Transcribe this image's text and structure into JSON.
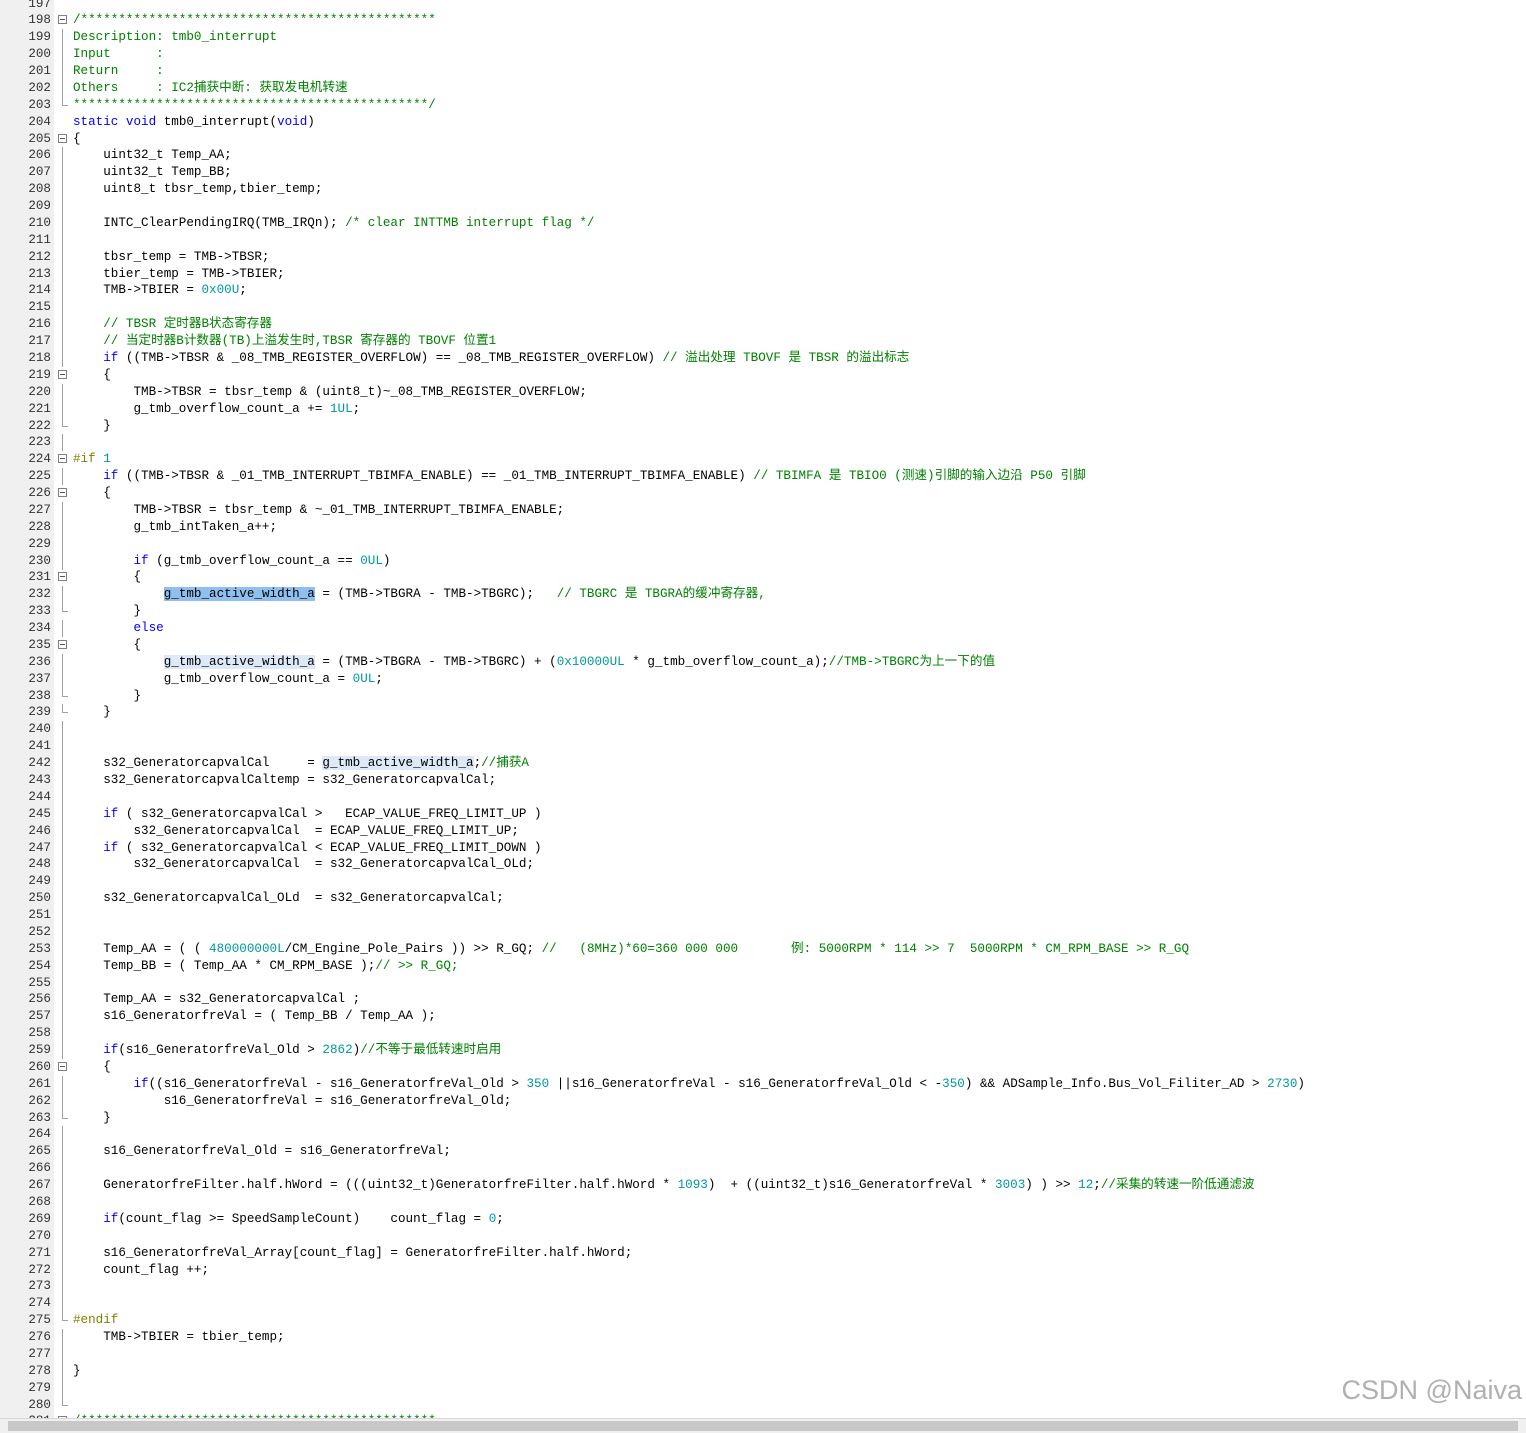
{
  "watermark": "CSDN @Naiva",
  "lines": [
    {
      "n": "197",
      "s": []
    },
    {
      "n": "198",
      "f": "box",
      "s": [
        {
          "t": "/***********************************************",
          "c": "c"
        }
      ]
    },
    {
      "n": "199",
      "f": "line",
      "s": [
        {
          "t": "Description: tmb0_interrupt",
          "c": "c"
        }
      ]
    },
    {
      "n": "200",
      "f": "line",
      "s": [
        {
          "t": "Input      :",
          "c": "c"
        }
      ]
    },
    {
      "n": "201",
      "f": "line",
      "s": [
        {
          "t": "Return     :",
          "c": "c"
        }
      ]
    },
    {
      "n": "202",
      "f": "line",
      "s": [
        {
          "t": "Others     : IC2捕获中断: 获取发电机转速",
          "c": "c"
        }
      ]
    },
    {
      "n": "203",
      "f": "end",
      "s": [
        {
          "t": "***********************************************/",
          "c": "c"
        }
      ]
    },
    {
      "n": "204",
      "s": [
        {
          "t": "static void",
          "c": "k"
        },
        {
          "t": " tmb0_interrupt("
        },
        {
          "t": "void",
          "c": "k"
        },
        {
          "t": ")"
        }
      ]
    },
    {
      "n": "205",
      "f": "box",
      "s": [
        {
          "t": "{"
        }
      ]
    },
    {
      "n": "206",
      "f": "line",
      "s": [
        {
          "t": "    uint32_t Temp_AA;"
        }
      ]
    },
    {
      "n": "207",
      "f": "line",
      "s": [
        {
          "t": "    uint32_t Temp_BB;"
        }
      ]
    },
    {
      "n": "208",
      "f": "line",
      "s": [
        {
          "t": "    uint8_t tbsr_temp,tbier_temp;"
        }
      ]
    },
    {
      "n": "209",
      "f": "line",
      "s": []
    },
    {
      "n": "210",
      "f": "line",
      "s": [
        {
          "t": "    INTC_ClearPendingIRQ(TMB_IRQn); "
        },
        {
          "t": "/* clear INTTMB interrupt flag */",
          "c": "c"
        }
      ]
    },
    {
      "n": "211",
      "f": "line",
      "s": []
    },
    {
      "n": "212",
      "f": "line",
      "s": [
        {
          "t": "    tbsr_temp = TMB->TBSR;"
        }
      ]
    },
    {
      "n": "213",
      "f": "line",
      "s": [
        {
          "t": "    tbier_temp = TMB->TBIER;"
        }
      ]
    },
    {
      "n": "214",
      "f": "line",
      "s": [
        {
          "t": "    TMB->TBIER = "
        },
        {
          "t": "0x00U",
          "c": "n"
        },
        {
          "t": ";"
        }
      ]
    },
    {
      "n": "215",
      "f": "line",
      "s": []
    },
    {
      "n": "216",
      "f": "line",
      "s": [
        {
          "t": "    // TBSR 定时器B状态寄存器",
          "c": "c"
        }
      ]
    },
    {
      "n": "217",
      "f": "line",
      "s": [
        {
          "t": "    // 当定时器B计数器(TB)上溢发生时,TBSR 寄存器的 TBOVF 位置1",
          "c": "c"
        }
      ]
    },
    {
      "n": "218",
      "f": "line",
      "s": [
        {
          "t": "    "
        },
        {
          "t": "if",
          "c": "k"
        },
        {
          "t": " ((TMB->TBSR & _08_TMB_REGISTER_OVERFLOW) == _08_TMB_REGISTER_OVERFLOW) "
        },
        {
          "t": "// 溢出处理 TBOVF 是 TBSR 的溢出标志",
          "c": "c"
        }
      ]
    },
    {
      "n": "219",
      "f": "box",
      "s": [
        {
          "t": "    {"
        }
      ]
    },
    {
      "n": "220",
      "f": "line",
      "s": [
        {
          "t": "        TMB->TBSR = tbsr_temp & (uint8_t)~_08_TMB_REGISTER_OVERFLOW;"
        }
      ]
    },
    {
      "n": "221",
      "f": "line",
      "s": [
        {
          "t": "        g_tmb_overflow_count_a += "
        },
        {
          "t": "1UL",
          "c": "n"
        },
        {
          "t": ";"
        }
      ]
    },
    {
      "n": "222",
      "f": "end",
      "s": [
        {
          "t": "    }"
        }
      ]
    },
    {
      "n": "223",
      "f": "line",
      "s": []
    },
    {
      "n": "224",
      "f": "box",
      "s": [
        {
          "t": "#if",
          "c": "p"
        },
        {
          "t": " "
        },
        {
          "t": "1",
          "c": "n"
        }
      ]
    },
    {
      "n": "225",
      "f": "line",
      "s": [
        {
          "t": "    "
        },
        {
          "t": "if",
          "c": "k"
        },
        {
          "t": " ((TMB->TBSR & _01_TMB_INTERRUPT_TBIMFA_ENABLE) == _01_TMB_INTERRUPT_TBIMFA_ENABLE) "
        },
        {
          "t": "// TBIMFA 是 TBIO0 (测速)引脚的输入边沿 P50 引脚",
          "c": "c"
        }
      ]
    },
    {
      "n": "226",
      "f": "box",
      "s": [
        {
          "t": "    {"
        }
      ]
    },
    {
      "n": "227",
      "f": "line",
      "s": [
        {
          "t": "        TMB->TBSR = tbsr_temp & ~_01_TMB_INTERRUPT_TBIMFA_ENABLE;"
        }
      ]
    },
    {
      "n": "228",
      "f": "line",
      "s": [
        {
          "t": "        g_tmb_intTaken_a++;"
        }
      ]
    },
    {
      "n": "229",
      "f": "line",
      "s": []
    },
    {
      "n": "230",
      "f": "line",
      "s": [
        {
          "t": "        "
        },
        {
          "t": "if",
          "c": "k"
        },
        {
          "t": " (g_tmb_overflow_count_a == "
        },
        {
          "t": "0UL",
          "c": "n"
        },
        {
          "t": ")"
        }
      ]
    },
    {
      "n": "231",
      "f": "box",
      "s": [
        {
          "t": "        {"
        }
      ]
    },
    {
      "n": "232",
      "f": "line",
      "s": [
        {
          "t": "            "
        },
        {
          "t": "g_tmb_active_width_a",
          "h": "hl"
        },
        {
          "t": " = (TMB->TBGRA - TMB->TBGRC);   "
        },
        {
          "t": "// TBGRC 是 TBGRA的缓冲寄存器,",
          "c": "c"
        }
      ]
    },
    {
      "n": "233",
      "f": "end",
      "s": [
        {
          "t": "        }"
        }
      ]
    },
    {
      "n": "234",
      "f": "line",
      "s": [
        {
          "t": "        "
        },
        {
          "t": "else",
          "c": "k"
        }
      ]
    },
    {
      "n": "235",
      "f": "box",
      "s": [
        {
          "t": "        {"
        }
      ]
    },
    {
      "n": "236",
      "f": "line",
      "s": [
        {
          "t": "            "
        },
        {
          "t": "g_tmb_active_width_a",
          "h": "hl2"
        },
        {
          "t": " = (TMB->TBGRA - TMB->TBGRC) + ("
        },
        {
          "t": "0x10000UL",
          "c": "n"
        },
        {
          "t": " * g_tmb_overflow_count_a);"
        },
        {
          "t": "//TMB->TBGRC为上一下的值",
          "c": "c"
        }
      ]
    },
    {
      "n": "237",
      "f": "line",
      "s": [
        {
          "t": "            g_tmb_overflow_count_a = "
        },
        {
          "t": "0UL",
          "c": "n"
        },
        {
          "t": ";"
        }
      ]
    },
    {
      "n": "238",
      "f": "end",
      "s": [
        {
          "t": "        }"
        }
      ]
    },
    {
      "n": "239",
      "f": "end",
      "s": [
        {
          "t": "    }"
        }
      ]
    },
    {
      "n": "240",
      "f": "line",
      "s": []
    },
    {
      "n": "241",
      "f": "line",
      "s": []
    },
    {
      "n": "242",
      "f": "line",
      "s": [
        {
          "t": "    s32_GeneratorcapvalCal     = "
        },
        {
          "t": "g_tmb_active_width_a",
          "h": "hl2"
        },
        {
          "t": ";"
        },
        {
          "t": "//捕获A",
          "c": "c"
        }
      ]
    },
    {
      "n": "243",
      "f": "line",
      "s": [
        {
          "t": "    s32_GeneratorcapvalCaltemp = s32_GeneratorcapvalCal;"
        }
      ]
    },
    {
      "n": "244",
      "f": "line",
      "s": []
    },
    {
      "n": "245",
      "f": "line",
      "s": [
        {
          "t": "    "
        },
        {
          "t": "if",
          "c": "k"
        },
        {
          "t": " ( s32_GeneratorcapvalCal >   ECAP_VALUE_FREQ_LIMIT_UP )"
        }
      ]
    },
    {
      "n": "246",
      "f": "line",
      "s": [
        {
          "t": "        s32_GeneratorcapvalCal  = ECAP_VALUE_FREQ_LIMIT_UP;"
        }
      ]
    },
    {
      "n": "247",
      "f": "line",
      "s": [
        {
          "t": "    "
        },
        {
          "t": "if",
          "c": "k"
        },
        {
          "t": " ( s32_GeneratorcapvalCal < ECAP_VALUE_FREQ_LIMIT_DOWN )"
        }
      ]
    },
    {
      "n": "248",
      "f": "line",
      "s": [
        {
          "t": "        s32_GeneratorcapvalCal  = s32_GeneratorcapvalCal_OLd;"
        }
      ]
    },
    {
      "n": "249",
      "f": "line",
      "s": []
    },
    {
      "n": "250",
      "f": "line",
      "s": [
        {
          "t": "    s32_GeneratorcapvalCal_OLd  = s32_GeneratorcapvalCal;"
        }
      ]
    },
    {
      "n": "251",
      "f": "line",
      "s": []
    },
    {
      "n": "252",
      "f": "line",
      "s": []
    },
    {
      "n": "253",
      "f": "line",
      "s": [
        {
          "t": "    Temp_AA = ( ( "
        },
        {
          "t": "480000000L",
          "c": "n"
        },
        {
          "t": "/CM_Engine_Pole_Pairs )) >> R_GQ; "
        },
        {
          "t": "//   (8MHz)*60=360 000 000       例: 5000RPM * 114 >> 7  5000RPM * CM_RPM_BASE >> R_GQ",
          "c": "c"
        }
      ]
    },
    {
      "n": "254",
      "f": "line",
      "s": [
        {
          "t": "    Temp_BB = ( Temp_AA * CM_RPM_BASE );"
        },
        {
          "t": "// >> R_GQ;",
          "c": "c"
        }
      ]
    },
    {
      "n": "255",
      "f": "line",
      "s": []
    },
    {
      "n": "256",
      "f": "line",
      "s": [
        {
          "t": "    Temp_AA = s32_GeneratorcapvalCal ;"
        }
      ]
    },
    {
      "n": "257",
      "f": "line",
      "s": [
        {
          "t": "    s16_GeneratorfreVal = ( Temp_BB / Temp_AA );"
        }
      ]
    },
    {
      "n": "258",
      "f": "line",
      "s": []
    },
    {
      "n": "259",
      "f": "line",
      "s": [
        {
          "t": "    "
        },
        {
          "t": "if",
          "c": "k"
        },
        {
          "t": "(s16_GeneratorfreVal_Old > "
        },
        {
          "t": "2862",
          "c": "n"
        },
        {
          "t": ")"
        },
        {
          "t": "//不等于最低转速时启用",
          "c": "c"
        }
      ]
    },
    {
      "n": "260",
      "f": "box",
      "s": [
        {
          "t": "    {"
        }
      ]
    },
    {
      "n": "261",
      "f": "line",
      "s": [
        {
          "t": "        "
        },
        {
          "t": "if",
          "c": "k"
        },
        {
          "t": "((s16_GeneratorfreVal - s16_GeneratorfreVal_Old > "
        },
        {
          "t": "350",
          "c": "n"
        },
        {
          "t": " ||s16_GeneratorfreVal - s16_GeneratorfreVal_Old < -"
        },
        {
          "t": "350",
          "c": "n"
        },
        {
          "t": ") && ADSample_Info.Bus_Vol_Filiter_AD > "
        },
        {
          "t": "2730",
          "c": "n"
        },
        {
          "t": ")"
        }
      ]
    },
    {
      "n": "262",
      "f": "line",
      "s": [
        {
          "t": "            s16_GeneratorfreVal = s16_GeneratorfreVal_Old;"
        }
      ]
    },
    {
      "n": "263",
      "f": "end",
      "s": [
        {
          "t": "    }"
        }
      ]
    },
    {
      "n": "264",
      "f": "line",
      "s": []
    },
    {
      "n": "265",
      "f": "line",
      "s": [
        {
          "t": "    s16_GeneratorfreVal_Old = s16_GeneratorfreVal;"
        }
      ]
    },
    {
      "n": "266",
      "f": "line",
      "s": []
    },
    {
      "n": "267",
      "f": "line",
      "s": [
        {
          "t": "    GeneratorfreFilter.half.hWord = (((uint32_t)GeneratorfreFilter.half.hWord * "
        },
        {
          "t": "1093",
          "c": "n"
        },
        {
          "t": ")  + ((uint32_t)s16_GeneratorfreVal * "
        },
        {
          "t": "3003",
          "c": "n"
        },
        {
          "t": ") ) >> "
        },
        {
          "t": "12",
          "c": "n"
        },
        {
          "t": ";"
        },
        {
          "t": "//采集的转速一阶低通滤波",
          "c": "c"
        }
      ]
    },
    {
      "n": "268",
      "f": "line",
      "s": []
    },
    {
      "n": "269",
      "f": "line",
      "s": [
        {
          "t": "    "
        },
        {
          "t": "if",
          "c": "k"
        },
        {
          "t": "(count_flag >= SpeedSampleCount)    count_flag = "
        },
        {
          "t": "0",
          "c": "n"
        },
        {
          "t": ";"
        }
      ]
    },
    {
      "n": "270",
      "f": "line",
      "s": []
    },
    {
      "n": "271",
      "f": "line",
      "s": [
        {
          "t": "    s16_GeneratorfreVal_Array[count_flag] = GeneratorfreFilter.half.hWord;"
        }
      ]
    },
    {
      "n": "272",
      "f": "line",
      "s": [
        {
          "t": "    count_flag ++;"
        }
      ]
    },
    {
      "n": "273",
      "f": "line",
      "s": []
    },
    {
      "n": "274",
      "f": "line",
      "s": []
    },
    {
      "n": "275",
      "f": "end",
      "s": [
        {
          "t": "#endif",
          "c": "p"
        }
      ]
    },
    {
      "n": "276",
      "f": "line",
      "s": [
        {
          "t": "    TMB->TBIER = tbier_temp;"
        }
      ]
    },
    {
      "n": "277",
      "f": "line",
      "s": []
    },
    {
      "n": "278",
      "f": "line",
      "s": [
        {
          "t": "}"
        }
      ]
    },
    {
      "n": "279",
      "f": "line",
      "s": []
    },
    {
      "n": "280",
      "f": "end",
      "s": []
    },
    {
      "n": "281",
      "f": "box",
      "s": [
        {
          "t": "/***********************************************",
          "c": "c"
        }
      ]
    }
  ]
}
